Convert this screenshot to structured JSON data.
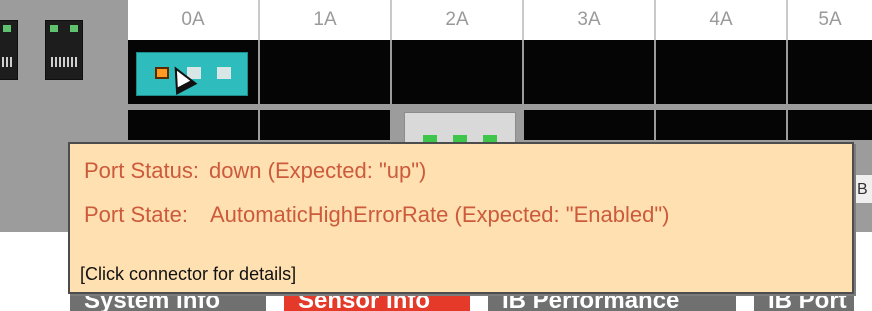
{
  "columns": [
    "0A",
    "1A",
    "2A",
    "3A",
    "4A",
    "5A"
  ],
  "side_box_label": "B",
  "tooltip": {
    "port_status_label": "Port Status:",
    "port_status_value": "down (Expected: \"up\")",
    "port_state_label": "Port State:",
    "port_state_value": "AutomaticHighErrorRate (Expected: \"Enabled\")",
    "footer": "[Click connector for details]"
  },
  "tabs": [
    "System Info",
    "Sensor Info",
    "IB Performance",
    "IB Port"
  ],
  "colors": {
    "tooltip_bg": "#ffe0b0",
    "tooltip_text": "#cc5a3c",
    "connector_teal": "#2fbcbc",
    "port_down": "#ff9a22",
    "port_led_green": "#3ec64b",
    "tab_gray": "#707070",
    "tab_active": "#e53a2a"
  },
  "icons": {
    "cursor": "mouse-pointer-icon",
    "jack": "ethernet-jack-icon"
  }
}
